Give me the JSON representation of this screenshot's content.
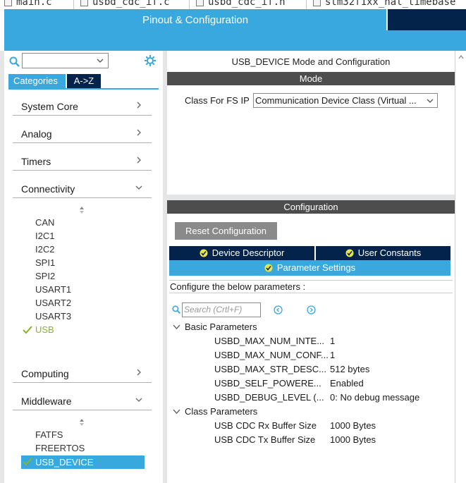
{
  "file_tabs": [
    "main.c",
    "usbd_cdc_if.c",
    "usbd_cdc_if.h",
    "stm32f1xx_hal_timebase"
  ],
  "header": {
    "title": "Pinout & Configuration"
  },
  "left": {
    "search": {
      "value": ""
    },
    "tabs": [
      {
        "label": "Categories",
        "active": true
      },
      {
        "label": "A->Z",
        "active": false
      }
    ],
    "categories": {
      "system_core": "System Core",
      "analog": "Analog",
      "timers": "Timers",
      "connectivity": "Connectivity",
      "computing": "Computing",
      "middleware": "Middleware"
    },
    "connectivity_items": [
      {
        "label": "CAN",
        "enabled": false
      },
      {
        "label": "I2C1",
        "enabled": false
      },
      {
        "label": "I2C2",
        "enabled": false
      },
      {
        "label": "SPI1",
        "enabled": false
      },
      {
        "label": "SPI2",
        "enabled": false
      },
      {
        "label": "USART1",
        "enabled": false
      },
      {
        "label": "USART2",
        "enabled": false
      },
      {
        "label": "USART3",
        "enabled": false
      },
      {
        "label": "USB",
        "enabled": true
      }
    ],
    "middleware_items": [
      {
        "label": "FATFS",
        "enabled": false
      },
      {
        "label": "FREERTOS",
        "enabled": false
      },
      {
        "label": "USB_DEVICE",
        "enabled": true,
        "selected": true
      }
    ]
  },
  "right": {
    "title": "USB_DEVICE Mode and Configuration",
    "mode_bar": "Mode",
    "class_label": "Class For FS IP",
    "class_value": "Communication Device Class (Virtual ...",
    "config_bar": "Configuration",
    "reset_button": "Reset Configuration",
    "tabs": {
      "device_descriptor": "Device Descriptor",
      "user_constants": "User Constants",
      "parameter_settings": "Parameter Settings"
    },
    "configure_text": "Configure the below parameters :",
    "search_placeholder": "Search (Crtl+F)",
    "groups": [
      {
        "name": "Basic Parameters",
        "params": [
          {
            "name": "USBD_MAX_NUM_INTE...",
            "value": "1"
          },
          {
            "name": "USBD_MAX_NUM_CONF...",
            "value": "1"
          },
          {
            "name": "USBD_MAX_STR_DESC...",
            "value": "512 bytes"
          },
          {
            "name": "USBD_SELF_POWERE...",
            "value": "Enabled"
          },
          {
            "name": "USBD_DEBUG_LEVEL (...",
            "value": "0: No debug message"
          }
        ]
      },
      {
        "name": "Class Parameters",
        "params": [
          {
            "name": "USB CDC Rx Buffer Size",
            "value": "1000 Bytes"
          },
          {
            "name": "USB CDC Tx Buffer Size",
            "value": "1000 Bytes"
          }
        ]
      }
    ]
  },
  "colors": {
    "accent": "#39a8df",
    "dark": "#03234b",
    "enabled": "#8ab22a",
    "bar": "#4d4d4d"
  }
}
